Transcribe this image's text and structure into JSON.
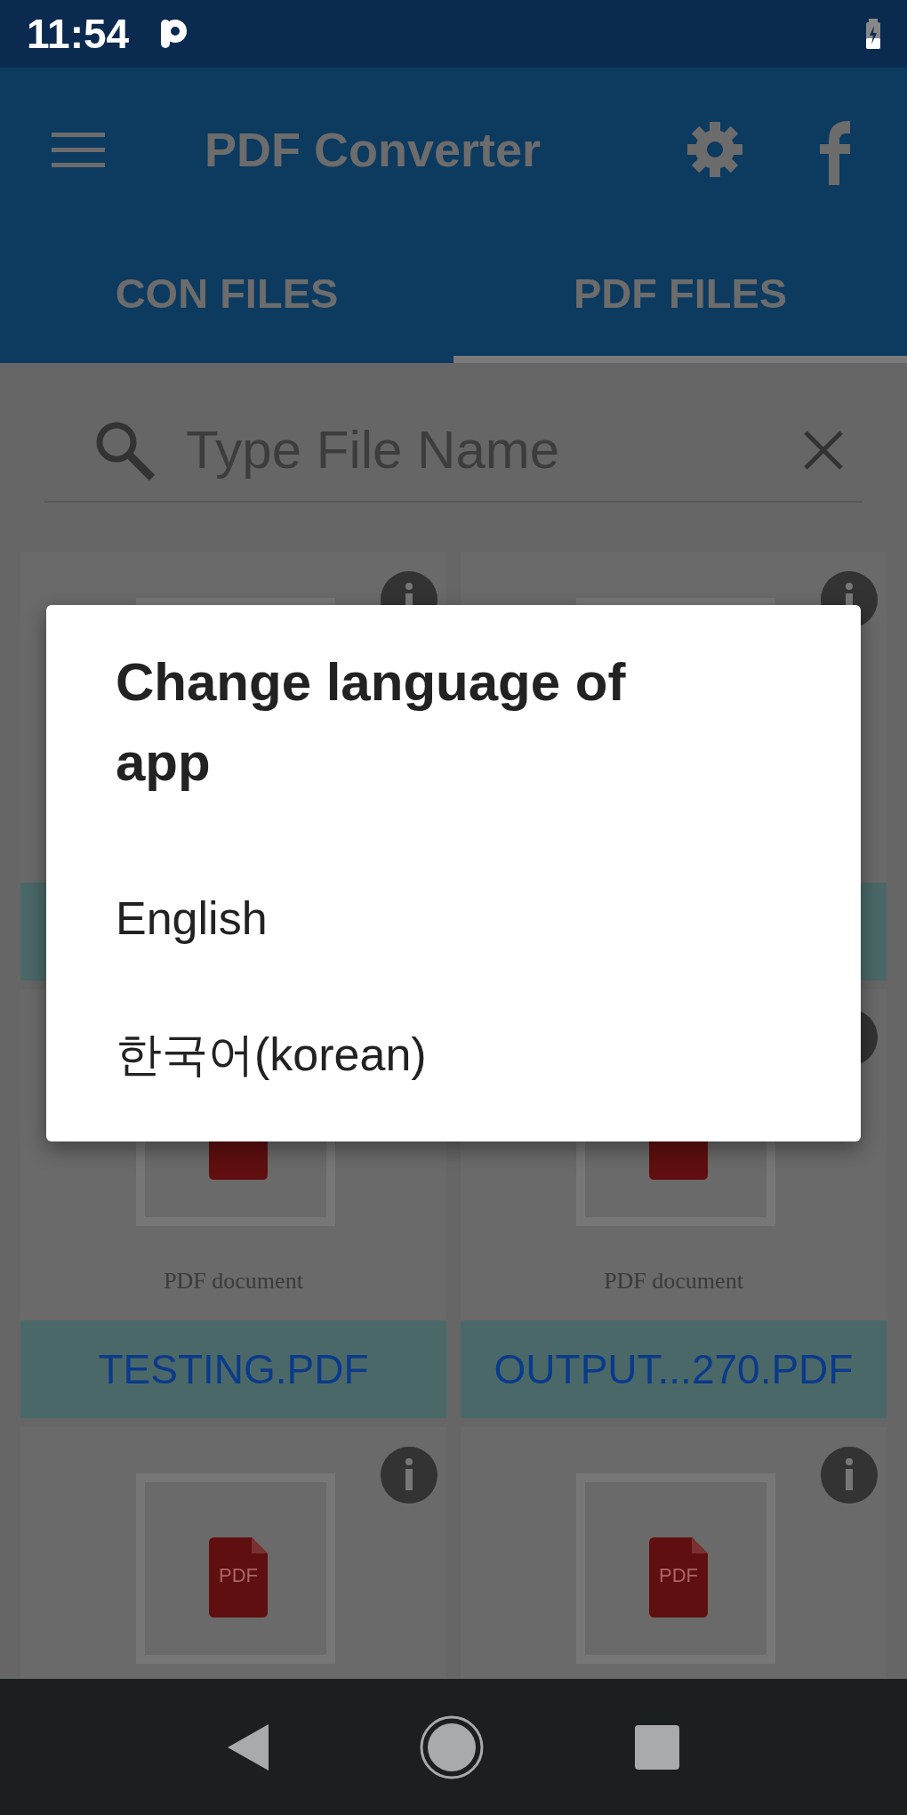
{
  "status_bar": {
    "time": "11:54"
  },
  "app_bar": {
    "title": "PDF Converter"
  },
  "tabs": [
    {
      "label": "CON FILES",
      "selected": false
    },
    {
      "label": "PDF FILES",
      "selected": true
    }
  ],
  "search": {
    "placeholder": "Type File Name"
  },
  "files": [
    {
      "kind": "pdf"
    },
    {
      "kind": "pdf"
    },
    {
      "kind": "pdf",
      "caption": "PDF document",
      "name": "TESTING.PDF"
    },
    {
      "kind": "pdf",
      "caption": "PDF document",
      "name": "OUTPUT...270.PDF"
    },
    {
      "kind": "pdf",
      "badge": "PDF"
    },
    {
      "kind": "pdf",
      "badge": "PDF"
    }
  ],
  "dialog": {
    "title": "Change language of app",
    "options": [
      {
        "label": "English"
      },
      {
        "label": "한국어(korean)"
      }
    ]
  }
}
